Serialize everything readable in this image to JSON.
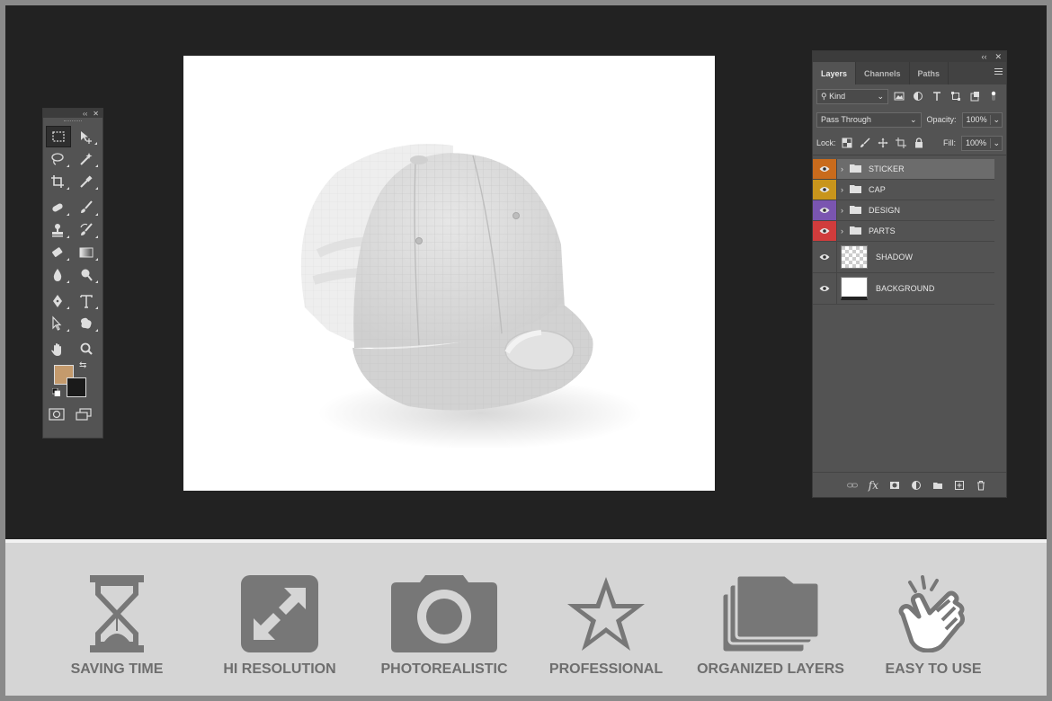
{
  "toolbar": {
    "header_icons": [
      "collapse-icon",
      "close-icon"
    ],
    "tools": [
      "marquee-tool",
      "move-tool",
      "lasso-tool",
      "magic-wand-tool",
      "crop-tool",
      "eyedropper-tool",
      "healing-tool",
      "brush-tool",
      "stamp-tool",
      "history-brush-tool",
      "eraser-tool",
      "gradient-tool",
      "blur-tool",
      "dodge-tool",
      "pen-tool",
      "type-tool",
      "path-select-tool",
      "shape-tool",
      "hand-tool",
      "zoom-tool"
    ],
    "foreground_color": "#c49a6c",
    "background_color": "#1a1a1a"
  },
  "layers_panel": {
    "header": {
      "collapse": "‹‹",
      "close": "✕"
    },
    "tabs": [
      {
        "label": "Layers",
        "active": true
      },
      {
        "label": "Channels",
        "active": false
      },
      {
        "label": "Paths",
        "active": false
      }
    ],
    "filter": {
      "label": "Kind"
    },
    "blend_mode": "Pass Through",
    "opacity_label": "Opacity:",
    "opacity_value": "100%",
    "lock_label": "Lock:",
    "fill_label": "Fill:",
    "fill_value": "100%",
    "layers": [
      {
        "name": "STICKER",
        "type": "group",
        "color": "#c96b1c",
        "selected": true
      },
      {
        "name": "CAP",
        "type": "group",
        "color": "#c8951c",
        "selected": false
      },
      {
        "name": "DESIGN",
        "type": "group",
        "color": "#7a55b0",
        "selected": false
      },
      {
        "name": "PARTS",
        "type": "group",
        "color": "#d03c3c",
        "selected": false
      },
      {
        "name": "SHADOW",
        "type": "layer",
        "color": "",
        "selected": false
      },
      {
        "name": "BACKGROUND",
        "type": "layer",
        "color": "",
        "selected": false
      }
    ],
    "footer_icons": [
      "link-icon",
      "fx-icon",
      "mask-icon",
      "adjustment-icon",
      "group-folder-icon",
      "new-layer-icon",
      "trash-icon"
    ],
    "fx_label": "fx"
  },
  "features": [
    {
      "label": "SAVING TIME",
      "icon": "hourglass-icon"
    },
    {
      "label": "HI RESOLUTION",
      "icon": "expand-icon"
    },
    {
      "label": "PHOTOREALISTIC",
      "icon": "camera-icon"
    },
    {
      "label": "PROFESSIONAL",
      "icon": "star-icon"
    },
    {
      "label": "ORGANIZED LAYERS",
      "icon": "folders-icon"
    },
    {
      "label": "EASY TO USE",
      "icon": "tap-hand-icon"
    }
  ]
}
